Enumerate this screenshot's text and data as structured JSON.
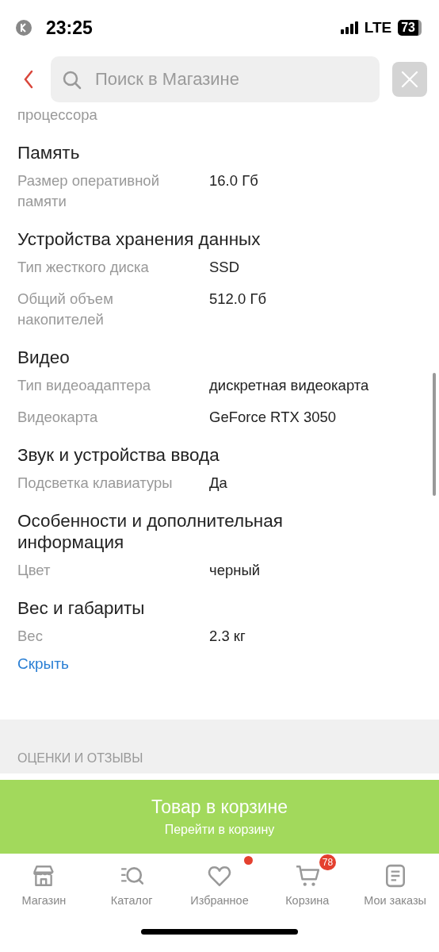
{
  "status_bar": {
    "time": "23:25",
    "network": "LTE",
    "battery": "73"
  },
  "search": {
    "placeholder": "Поиск в Магазине"
  },
  "specs": {
    "cut_label": "процессора",
    "sections": [
      {
        "title": "Память",
        "rows": [
          {
            "label": "Размер оперативной памяти",
            "value": "16.0 Гб"
          }
        ]
      },
      {
        "title": "Устройства хранения данных",
        "rows": [
          {
            "label": "Тип жесткого диска",
            "value": "SSD"
          },
          {
            "label": "Общий объем накопителей",
            "value": "512.0 Гб"
          }
        ]
      },
      {
        "title": "Видео",
        "rows": [
          {
            "label": "Тип видеоадаптера",
            "value": "дискретная видеокарта"
          },
          {
            "label": "Видеокарта",
            "value": "GeForce RTX 3050"
          }
        ]
      },
      {
        "title": "Звук и устройства ввода",
        "rows": [
          {
            "label": "Подсветка клавиатуры",
            "value": "Да"
          }
        ]
      },
      {
        "title": "Особенности и дополнительная информация",
        "rows": [
          {
            "label": "Цвет",
            "value": "черный"
          }
        ]
      },
      {
        "title": "Вес и габариты",
        "rows": [
          {
            "label": "Вес",
            "value": "2.3 кг"
          }
        ]
      }
    ],
    "hide_link": "Скрыть"
  },
  "reviews_header": "ОЦЕНКИ И ОТЗЫВЫ",
  "cart_banner": {
    "title": "Товар в корзине",
    "subtitle": "Перейти в корзину"
  },
  "nav": [
    {
      "kind": "shop",
      "label": "Магазин"
    },
    {
      "kind": "catalog",
      "label": "Каталог"
    },
    {
      "kind": "favorites",
      "label": "Избранное",
      "dot": true
    },
    {
      "kind": "cart",
      "label": "Корзина",
      "badge": "78"
    },
    {
      "kind": "orders",
      "label": "Мои заказы"
    }
  ]
}
